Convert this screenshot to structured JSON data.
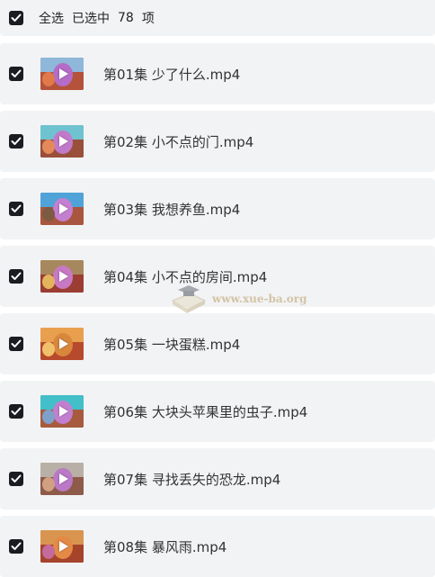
{
  "header": {
    "select_all": "全选",
    "selected_label": "已选中",
    "selected_count": "78",
    "items_suffix": "项"
  },
  "files": [
    {
      "name": "第01集 少了什么.mp4",
      "thumb": "purple-puppet"
    },
    {
      "name": "第02集 小不点的门.mp4",
      "thumb": "puppet-scene"
    },
    {
      "name": "第03集 我想养鱼.mp4",
      "thumb": "puppet-blue-sky"
    },
    {
      "name": "第04集 小不点的房间.mp4",
      "thumb": "puppet-room"
    },
    {
      "name": "第05集 一块蛋糕.mp4",
      "thumb": "puppet-orange"
    },
    {
      "name": "第06集 大块头苹果里的虫子.mp4",
      "thumb": "puppet-teal-sky"
    },
    {
      "name": "第07集 寻找丢失的恐龙.mp4",
      "thumb": "puppet-grey"
    },
    {
      "name": "第08集 暴风雨.mp4",
      "thumb": "puppet-orange-2"
    }
  ],
  "watermark": {
    "text": "www.xue-ba.org"
  },
  "colors": {
    "row_bg": "#f2f3f5",
    "checkbox": "#1b1b22",
    "watermark": "#c9b48a"
  }
}
